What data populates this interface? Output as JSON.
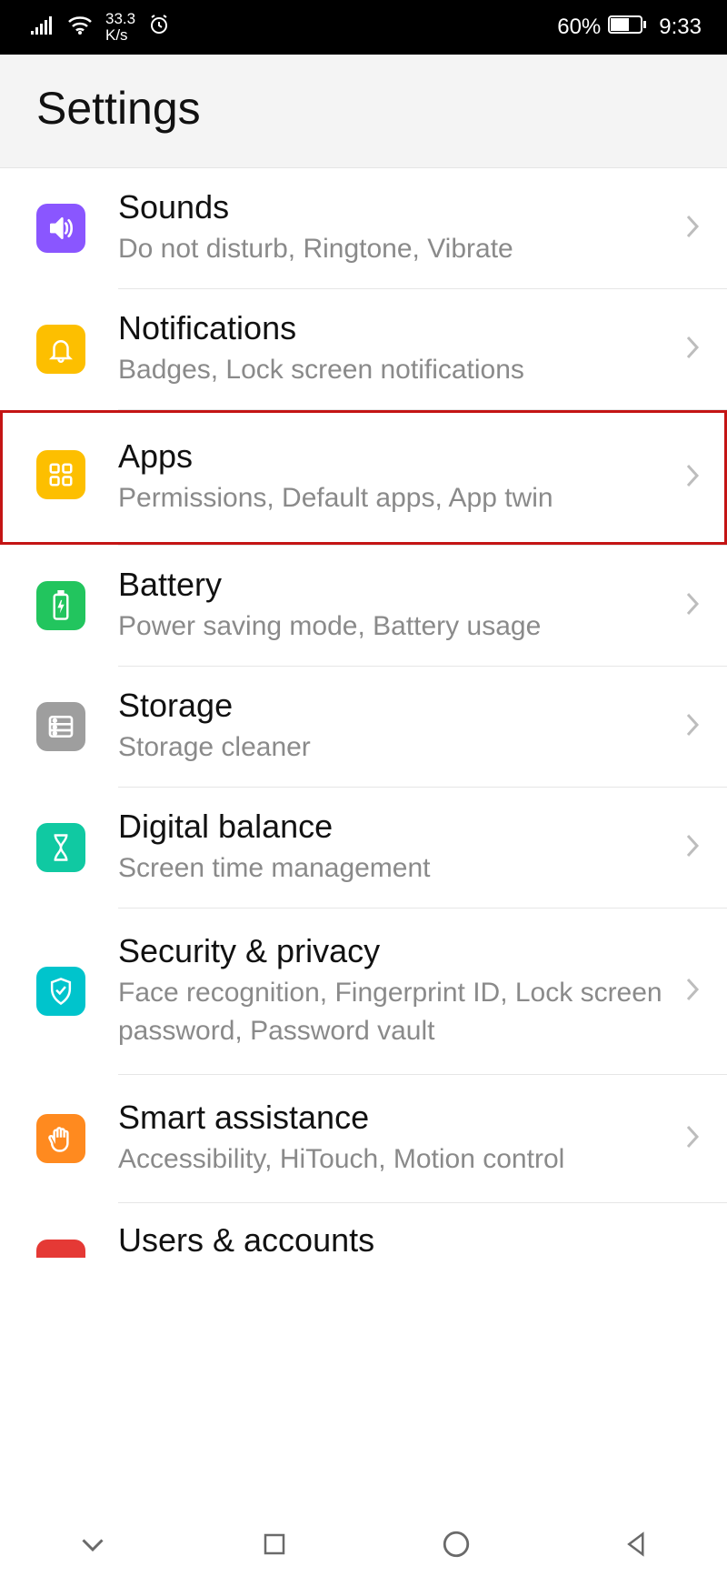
{
  "status": {
    "network_speed": "33.3",
    "speed_unit": "K/s",
    "battery": "60%",
    "time": "9:33"
  },
  "header": {
    "title": "Settings"
  },
  "items": [
    {
      "id": "sounds",
      "title": "Sounds",
      "sub": "Do not disturb, Ringtone, Vibrate",
      "icon": "speaker-icon",
      "bg": "bg-purple"
    },
    {
      "id": "notifications",
      "title": "Notifications",
      "sub": "Badges, Lock screen notifications",
      "icon": "bell-icon",
      "bg": "bg-yellow"
    },
    {
      "id": "apps",
      "title": "Apps",
      "sub": "Permissions, Default apps, App twin",
      "icon": "grid-icon",
      "bg": "bg-yellow",
      "highlight": true
    },
    {
      "id": "battery",
      "title": "Battery",
      "sub": "Power saving mode, Battery usage",
      "icon": "battery-icon",
      "bg": "bg-green"
    },
    {
      "id": "storage",
      "title": "Storage",
      "sub": "Storage cleaner",
      "icon": "storage-icon",
      "bg": "bg-gray"
    },
    {
      "id": "digital-balance",
      "title": "Digital balance",
      "sub": "Screen time management",
      "icon": "hourglass-icon",
      "bg": "bg-emerald"
    },
    {
      "id": "security",
      "title": "Security & privacy",
      "sub": "Face recognition, Fingerprint ID, Lock screen password, Password vault",
      "icon": "shield-icon",
      "bg": "bg-teal"
    },
    {
      "id": "smart-assistance",
      "title": "Smart assistance",
      "sub": "Accessibility, HiTouch, Motion control",
      "icon": "hand-icon",
      "bg": "bg-orange"
    },
    {
      "id": "users",
      "title": "Users & accounts",
      "sub": "",
      "icon": "user-icon",
      "bg": "bg-red",
      "partial": true
    }
  ]
}
